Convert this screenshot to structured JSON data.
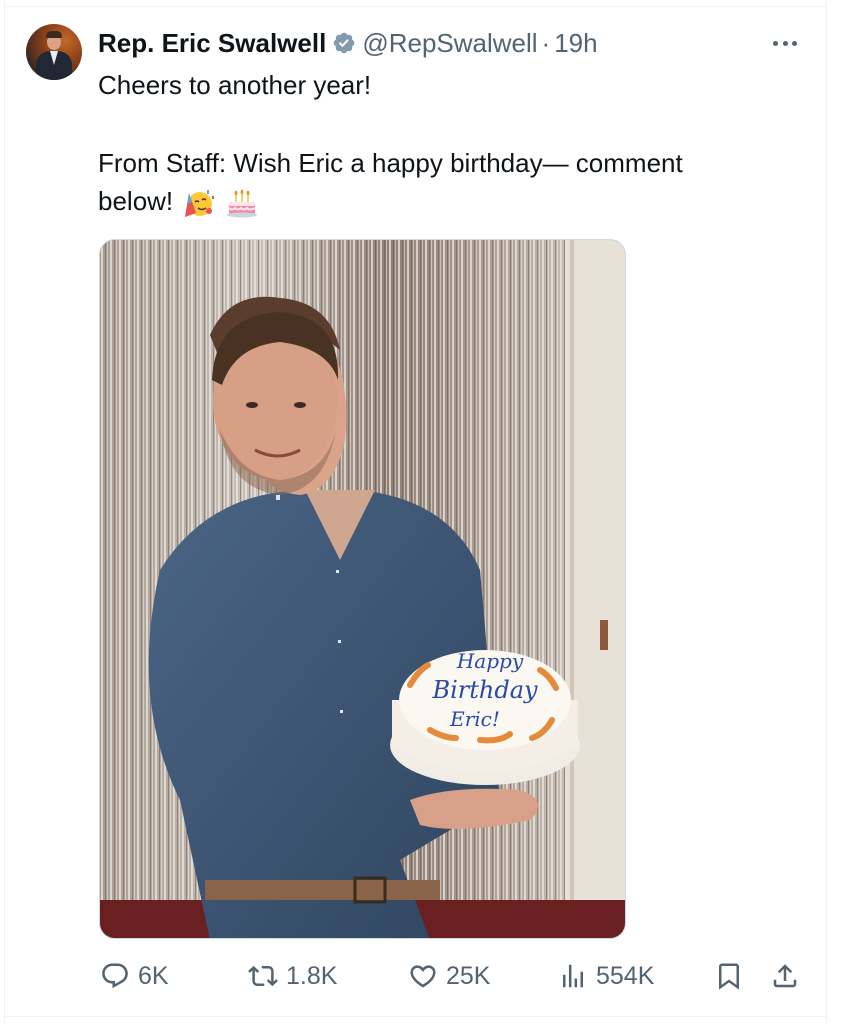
{
  "tweet": {
    "author_name": "Rep. Eric Swalwell",
    "author_handle": "@RepSwalwell",
    "separator": "·",
    "time": "19h",
    "verified_badge_color": "#829aab",
    "text_line_1": "Cheers to another year!",
    "text_line_2": "From Staff: Wish Eric a happy birthday— comment",
    "text_line_3": "below!",
    "emojis": [
      "partying-face-emoji",
      "birthday-cake-emoji"
    ],
    "media": {
      "description_icon": "photo",
      "cake_text": [
        "Happy",
        "Birthday",
        "Eric!"
      ]
    }
  },
  "actions": {
    "replies": "6K",
    "reposts": "1.8K",
    "likes": "25K",
    "views": "554K"
  },
  "colors": {
    "text_primary": "#0f1419",
    "text_secondary": "#536471",
    "border": "#eff3f4"
  }
}
